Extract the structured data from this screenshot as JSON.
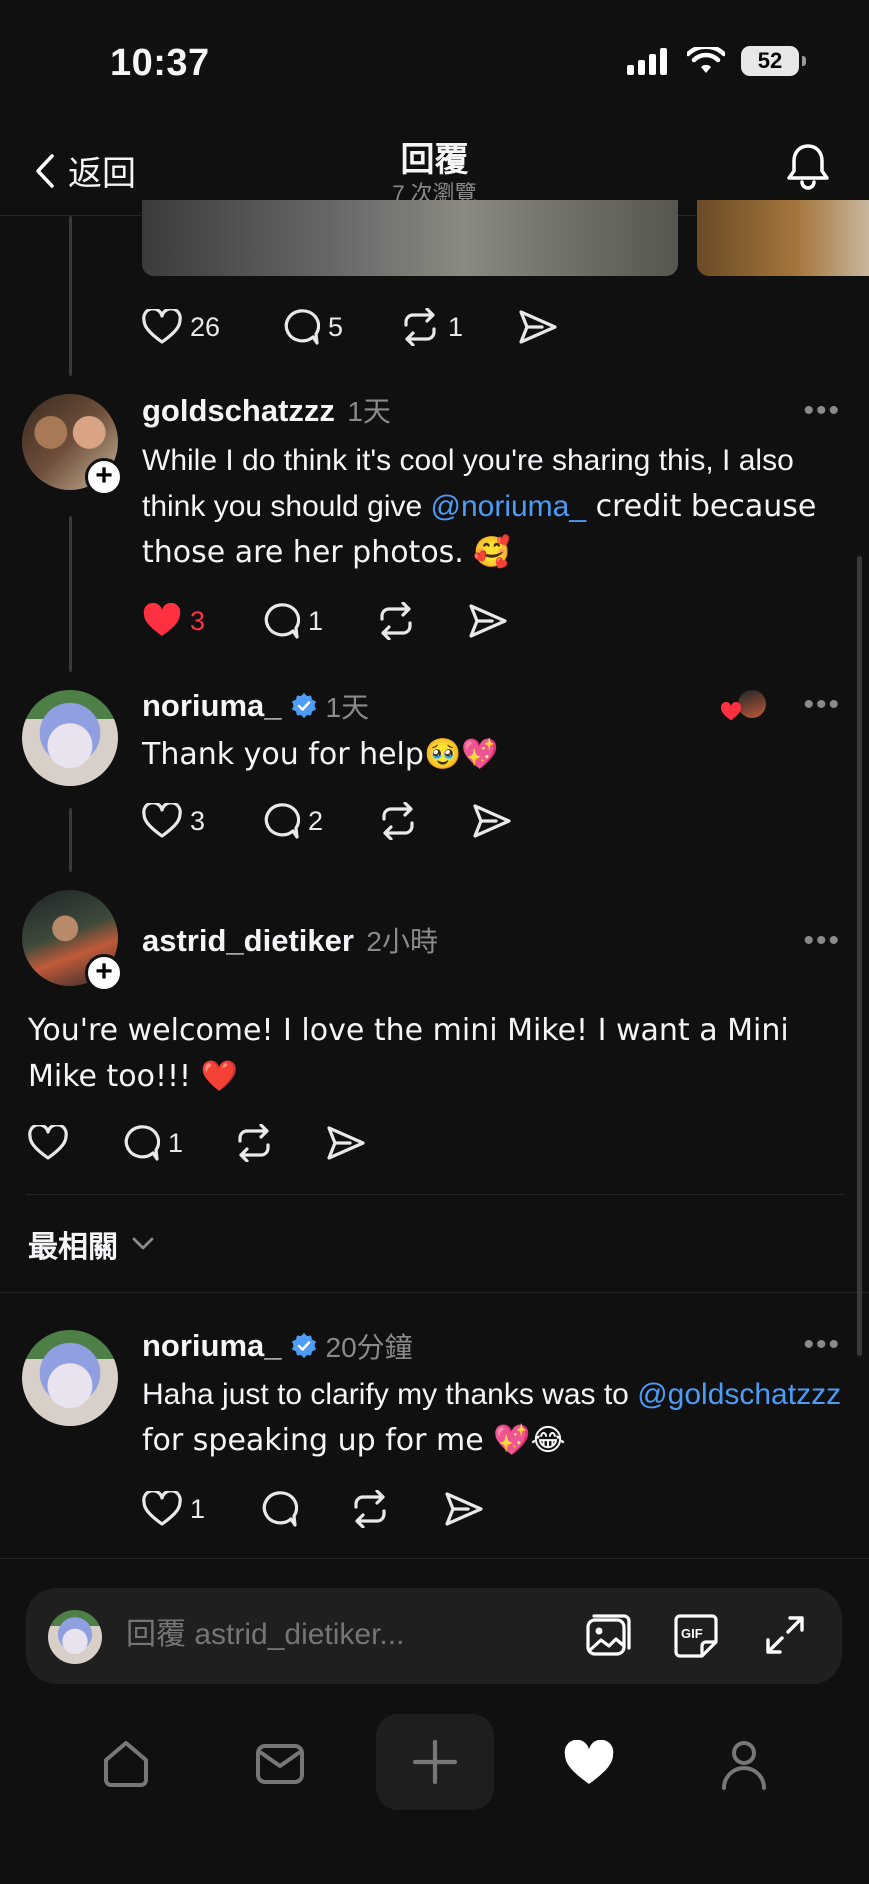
{
  "status_bar": {
    "time": "10:37",
    "battery": "52"
  },
  "header": {
    "back_label": "返回",
    "title": "回覆",
    "subtitle": "7 次瀏覽"
  },
  "top_post_actions": {
    "likes": "26",
    "comments": "5",
    "reposts": "1"
  },
  "replies": [
    {
      "username": "goldschatzzz",
      "time": "1天",
      "text_before": "While I do think it's cool you're sharing this, I also think you should give ",
      "mention": "@noriuma_",
      "text_after": " credit because those are her photos. 🥰",
      "likes": "3",
      "comments": "1",
      "liked": true
    },
    {
      "username": "noriuma_",
      "time": "1天",
      "text": "Thank you for help🥹💖",
      "likes": "3",
      "comments": "2"
    },
    {
      "username": "astrid_dietiker",
      "time": "2小時",
      "text": "You're welcome! I love the mini Mike! I want a Mini Mike too!!! ❤️",
      "likes": "",
      "comments": "1"
    }
  ],
  "sort_label": "最相關",
  "related_reply": {
    "username": "noriuma_",
    "time": "20分鐘",
    "text_before": "Haha just to clarify my thanks was to ",
    "mention": "@goldschatzzz",
    "text_after": " for speaking up for me 💖😂",
    "likes": "1"
  },
  "reply_input": {
    "placeholder": "回覆 astrid_dietiker..."
  },
  "colors": {
    "background": "#101010",
    "accent_blue": "#4c9bf5",
    "like_red": "#ff3040"
  },
  "icons": [
    "chevron-left-icon",
    "bell-icon",
    "heart-icon",
    "comment-icon",
    "repost-icon",
    "share-icon",
    "more-icon",
    "verified-icon",
    "image-icon",
    "gif-icon",
    "expand-icon",
    "home-icon",
    "inbox-icon",
    "plus-icon",
    "profile-icon"
  ]
}
